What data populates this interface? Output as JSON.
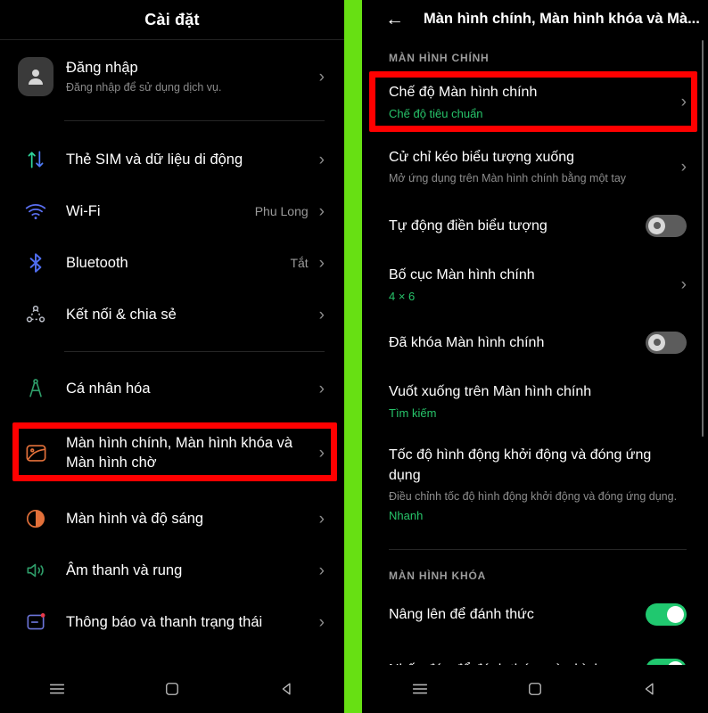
{
  "left_panel": {
    "header_title": "Cài đặt",
    "account": {
      "icon": "person-avatar-icon",
      "title": "Đăng nhập",
      "subtitle": "Đăng nhập để sử dụng dịch vụ."
    },
    "items": [
      {
        "icon": "sim-data-arrows-icon",
        "title": "Thẻ SIM và dữ liệu di động",
        "value": ""
      },
      {
        "icon": "wifi-icon",
        "title": "Wi-Fi",
        "value": "Phu Long"
      },
      {
        "icon": "bluetooth-icon",
        "title": "Bluetooth",
        "value": "Tắt"
      },
      {
        "icon": "connection-share-icon",
        "title": "Kết nối & chia sẻ",
        "value": ""
      },
      {
        "icon": "personalization-icon",
        "title": "Cá nhân hóa",
        "value": ""
      },
      {
        "icon": "home-screen-icon",
        "title": "Màn hình chính, Màn hình khóa và Màn hình chờ",
        "value": "",
        "highlighted": true
      },
      {
        "icon": "brightness-icon",
        "title": "Màn hình và độ sáng",
        "value": ""
      },
      {
        "icon": "sound-icon",
        "title": "Âm thanh và rung",
        "value": ""
      },
      {
        "icon": "notification-icon",
        "title": "Thông báo và thanh trạng thái",
        "value": ""
      }
    ],
    "navbar": {
      "menu": "menu-icon",
      "home": "home-icon",
      "back": "back-triangle-icon"
    }
  },
  "right_panel": {
    "back_icon": "back-arrow-icon",
    "header_title": "Màn hình chính, Màn hình khóa và Mà...",
    "sections": [
      {
        "label": "MÀN HÌNH CHÍNH",
        "rows": [
          {
            "title": "Chế độ Màn hình chính",
            "green": "Chế độ tiêu chuẩn",
            "control": "chevron",
            "highlighted": true
          },
          {
            "title": "Cử chỉ kéo biểu tượng xuống",
            "sub": "Mở ứng dụng trên Màn hình chính bằng một tay",
            "control": "chevron"
          },
          {
            "title": "Tự động điền biểu tượng",
            "control": "toggle",
            "toggle_state": "off"
          },
          {
            "title": "Bố cục Màn hình chính",
            "green": "4 × 6",
            "control": "chevron"
          },
          {
            "title": "Đã khóa Màn hình chính",
            "control": "toggle",
            "toggle_state": "off"
          },
          {
            "title": "Vuốt xuống trên Màn hình chính",
            "green": "Tìm kiếm",
            "control": "none"
          },
          {
            "title": "Tốc độ hình động khởi động và đóng ứng dụng",
            "sub": "Điều chỉnh tốc độ hình động khởi động và đóng ứng dụng.",
            "green": "Nhanh",
            "control": "none"
          }
        ]
      },
      {
        "label": "MÀN HÌNH KHÓA",
        "rows": [
          {
            "title": "Nâng lên để đánh thức",
            "control": "toggle",
            "toggle_state": "on"
          },
          {
            "title": "Nhấn đúp để đánh thức màn hình",
            "control": "toggle",
            "toggle_state": "on"
          }
        ]
      }
    ],
    "navbar": {
      "menu": "menu-icon",
      "home": "home-icon",
      "back": "back-triangle-icon"
    }
  },
  "colors": {
    "divider_green": "#67e013",
    "highlight_red": "#ff0000",
    "accent_green": "#27c46a",
    "toggle_on": "#20c86f",
    "toggle_off": "#5c5c5c",
    "background": "#000000"
  }
}
